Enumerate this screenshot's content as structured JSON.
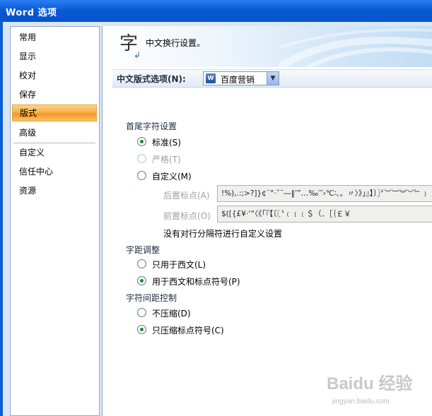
{
  "window": {
    "title": "Word 选项"
  },
  "sidebar": {
    "items": [
      {
        "label": "常用"
      },
      {
        "label": "显示"
      },
      {
        "label": "校对"
      },
      {
        "label": "保存"
      },
      {
        "label": "版式",
        "selected": true
      },
      {
        "label": "高级"
      },
      {
        "label": "自定义"
      },
      {
        "label": "信任中心"
      },
      {
        "label": "资源"
      }
    ]
  },
  "banner": {
    "icon": "font-char-icon",
    "icon_char": "字",
    "text": "中文换行设置。"
  },
  "section": {
    "label": "中文版式选项(N):",
    "select_value": "百度营销"
  },
  "first_last": {
    "heading": "首尾字符设置",
    "options": [
      {
        "label": "标准(S)",
        "checked": true,
        "disabled": false
      },
      {
        "label": "严格(T)",
        "checked": false,
        "disabled": true
      },
      {
        "label": "自定义(M)",
        "checked": false,
        "disabled": false
      }
    ],
    "following_label": "后置标点(A)",
    "following_value": "!%),.:;>?]}¢¨°·ˇˉ―‖’”…‰′″›℃∶、。〃〉》」』】〕〗〞︶︺︾﹀﹄﹚﹜﹞！＂％＇），．：；？］｝～",
    "leading_label": "前置标点(O)",
    "leading_value": "$([{£¥·‘“〈《「『【〔〖〝﹙﹛﹝＄（．［｛￡￥",
    "note": "没有对行分隔符进行自定义设置"
  },
  "spacing": {
    "heading": "字距调整",
    "options": [
      {
        "label": "只用于西文(L)",
        "checked": false
      },
      {
        "label": "用于西文和标点符号(P)",
        "checked": true
      }
    ]
  },
  "compress": {
    "heading": "字符间距控制",
    "options": [
      {
        "label": "不压缩(D)",
        "checked": false
      },
      {
        "label": "只压缩标点符号(C)",
        "checked": true
      }
    ]
  },
  "watermark": {
    "text": "Baidu 经验",
    "sub": "jingyan.baidu.com"
  },
  "colors": {
    "title_bar": "#0a5ad6",
    "selected_item": "#f9b049",
    "client_bg": "#d9e6f5"
  }
}
